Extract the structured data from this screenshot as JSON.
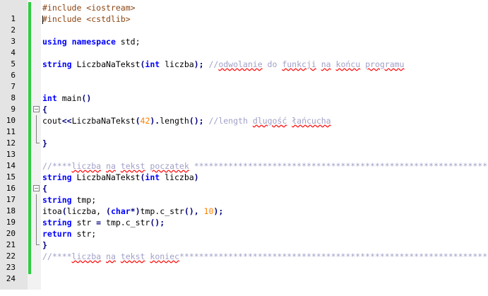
{
  "editor": {
    "language": "C++",
    "colors": {
      "preprocessor": "#8b4513",
      "keyword": "#0000ff",
      "comment": "#a0a0c8",
      "number": "#ff8000",
      "operator": "#000080",
      "change_bar": "#2ecc40",
      "squiggle": "#ff0000"
    },
    "line_numbers": [
      "1",
      "2",
      "3",
      "4",
      "5",
      "6",
      "7",
      "8",
      "9",
      "10",
      "11",
      "12",
      "13",
      "14",
      "15",
      "16",
      "17",
      "18",
      "19",
      "20",
      "21",
      "22",
      "23",
      "24"
    ],
    "lines": {
      "l1": {
        "a": "#include <iostream>"
      },
      "l2": {
        "a": "#include <cstdlib>"
      },
      "l4": {
        "a": "using",
        "b": " ",
        "c": "namespace",
        "d": " std;"
      },
      "l6": {
        "a": "string",
        "b": " LiczbaNaTekst",
        "c": "(",
        "d": "int",
        "e": " liczba",
        "f": ");",
        "g": " //",
        "h": "odwolanie",
        "i": " do ",
        "j": "funkcji",
        "k": " ",
        "l": "na",
        "m": " ",
        "n": "końcu",
        "o": " ",
        "p": "programu"
      },
      "l9": {
        "a": "int",
        "b": " main",
        "c": "()"
      },
      "l10": {
        "a": "{"
      },
      "l11": {
        "a": "cout",
        "b": "<<",
        "c": "LiczbaNaTekst",
        "d": "(",
        "e": "42",
        "f": ").",
        "g": "length",
        "h": "();",
        "i": " //length ",
        "j": "dlugość",
        "k": " ",
        "l": "łańcucha"
      },
      "l13": {
        "a": "}"
      },
      "l15": {
        "a": "//****",
        "b": "liczba",
        "c": " ",
        "d": "na",
        "e": " ",
        "f": "tekst",
        "g": " ",
        "h": "poczatek",
        "i": " ****************************************************************"
      },
      "l16": {
        "a": "string",
        "b": " LiczbaNaTekst",
        "c": "(",
        "d": "int",
        "e": " liczba",
        "f": ")"
      },
      "l17": {
        "a": "{"
      },
      "l18": {
        "a": "string",
        "b": " tmp;"
      },
      "l19": {
        "a": "itoa",
        "b": "(",
        "c": "liczba, ",
        "d": "(",
        "e": "char",
        "f": "*)",
        "g": "tmp.c_str",
        "h": "(), ",
        "i": "10",
        "j": ");"
      },
      "l20": {
        "a": "string",
        "b": " str ",
        "c": "=",
        "d": " tmp.c_str",
        "e": "();"
      },
      "l21": {
        "a": "return",
        "b": " str;"
      },
      "l22": {
        "a": "}"
      },
      "l23": {
        "a": "//****",
        "b": "liczba",
        "c": " ",
        "d": "na",
        "e": " ",
        "f": "tekst",
        "g": " ",
        "h": "koniec",
        "i": "****************************************************************"
      }
    }
  }
}
